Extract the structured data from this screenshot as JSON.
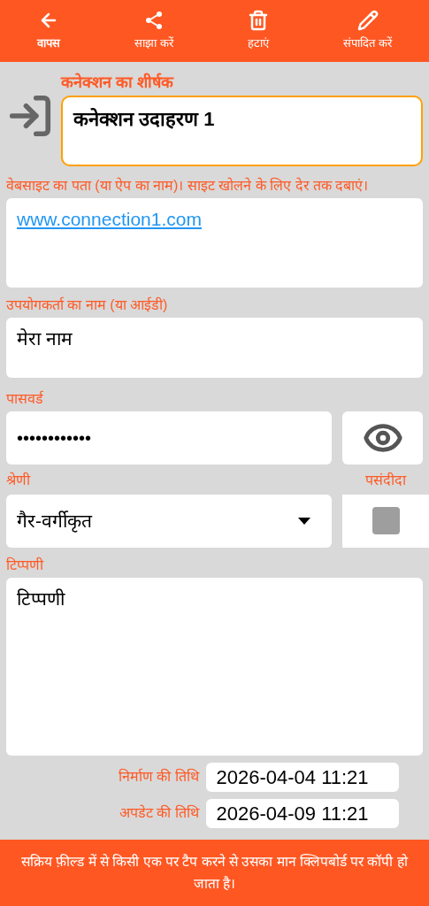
{
  "toolbar": [
    {
      "kind": "back",
      "label": "वापस",
      "selected": true
    },
    {
      "kind": "share",
      "label": "साझा करें",
      "selected": false
    },
    {
      "kind": "delete",
      "label": "हटाएं",
      "selected": false
    },
    {
      "kind": "edit",
      "label": "संपादित करें",
      "selected": false
    }
  ],
  "title_field": {
    "label": "कनेक्शन का शीर्षक",
    "value": "कनेक्शन उदाहरण 1"
  },
  "website_field": {
    "label": "वेबसाइट का पता (या ऐप का नाम)। साइट खोलने के लिए देर तक दबाएं।",
    "value": "www.connection1.com"
  },
  "username_field": {
    "label": "उपयोगकर्ता का नाम (या आईडी)",
    "value": "मेरा नाम"
  },
  "password_field": {
    "label": "पासवर्ड",
    "value": "••••••••••••"
  },
  "category": {
    "label": "श्रेणी",
    "value": "गैर-वर्गीकृत"
  },
  "favorite": {
    "label": "पसंदीदा",
    "checked": false
  },
  "notes": {
    "label": "टिप्पणी",
    "value": "टिप्पणी"
  },
  "dates": [
    {
      "label": "निर्माण की तिथि",
      "value": "2026-04-04 11:21"
    },
    {
      "label": "अपडेट की तिथि",
      "value": "2026-04-09 11:21"
    }
  ],
  "footer": "सक्रिय फ़ील्ड में से किसी एक पर टैप करने से उसका मान क्लिपबोर्ड पर कॉपी हो जाता है।"
}
